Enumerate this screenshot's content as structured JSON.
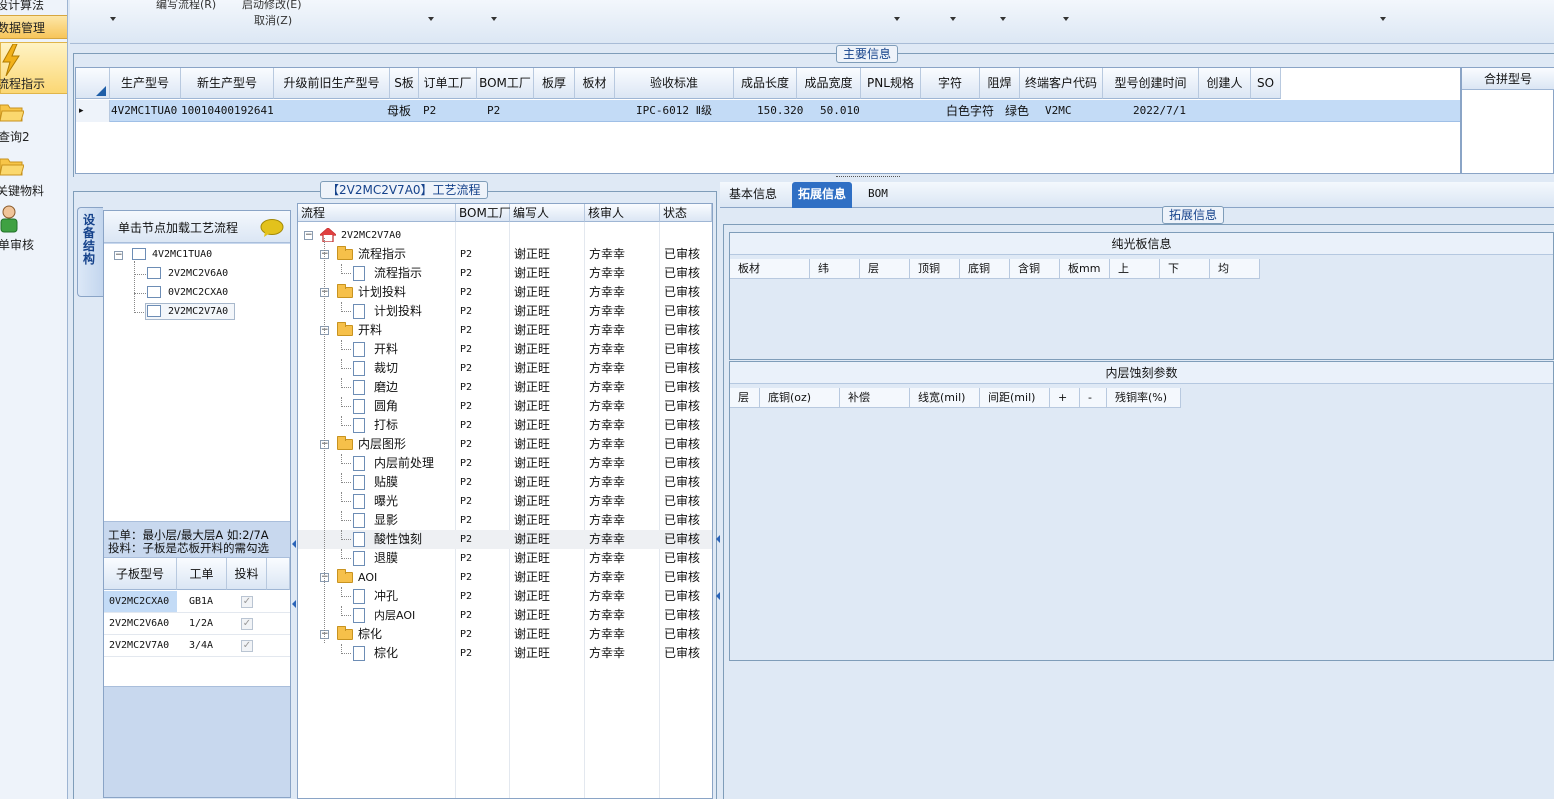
{
  "left_nav": {
    "items": [
      {
        "label": "设计算法"
      },
      {
        "label": "数据管理"
      },
      {
        "label": "流程指示"
      },
      {
        "label": "查询2"
      },
      {
        "label": "关键物料"
      },
      {
        "label": "单审核"
      }
    ]
  },
  "toolbar": {
    "edit_flow": "编写流程(R)",
    "start_modify": "启动修改(E)",
    "cancel": "取消(Z)"
  },
  "main_info": {
    "title": "主要信息",
    "columns": [
      "生产型号",
      "新生产型号",
      "升级前旧生产型号",
      "S板",
      "订单工厂",
      "BOM工厂",
      "板厚",
      "板材",
      "验收标准",
      "成品长度",
      "成品宽度",
      "PNL规格",
      "字符",
      "阻焊",
      "终端客户代码",
      "型号创建时间",
      "创建人",
      "SO"
    ],
    "row": {
      "marker": "▸",
      "生产型号": "4V2MC1TUA0",
      "新生产型号": "10010400192641",
      "升级前旧生产型号": "",
      "S板": "母板",
      "订单工厂": "P2",
      "BOM工厂": "P2",
      "板厚": "",
      "板材": "",
      "验收标准": "IPC-6012 Ⅱ级",
      "成品长度": "150.320",
      "成品宽度": "50.010",
      "PNL规格": "",
      "字符": "白色字符",
      "阻焊": "绿色",
      "终端客户代码": "V2MC",
      "型号创建时间": "2022/7/1",
      "创建人": "",
      "SO": ""
    },
    "merge_header": "合拼型号"
  },
  "device_panel": {
    "vertical_tab": "设备结构",
    "hint": "单击节点加载工艺流程",
    "tree_root": "4V2MC1TUA0",
    "tree_children": [
      "2V2MC2V6A0",
      "0V2MC2CXA0",
      "2V2MC2V7A0"
    ],
    "note_line1": "工单：最小层/最大层A 如:2/7A",
    "note_line2": "投料：子板是芯板开料的需勾选",
    "sub_columns": [
      "子板型号",
      "工单",
      "投料"
    ],
    "sub_rows": [
      {
        "model": "0V2MC2CXA0",
        "order": "GB1A"
      },
      {
        "model": "2V2MC2V6A0",
        "order": "1/2A"
      },
      {
        "model": "2V2MC2V7A0",
        "order": "3/4A"
      }
    ]
  },
  "flow_panel": {
    "title": "【2V2MC2V7A0】工艺流程",
    "columns": [
      "流程",
      "BOM工厂",
      "编写人",
      "核审人",
      "状态"
    ],
    "root": "2V2MC2V7A0",
    "rows": [
      {
        "level": 1,
        "type": "folder",
        "name": "流程指示",
        "bom": "P2",
        "writer": "谢正旺",
        "reviewer": "方幸幸",
        "status": "已审核"
      },
      {
        "level": 2,
        "type": "doc",
        "name": "流程指示",
        "bom": "P2",
        "writer": "谢正旺",
        "reviewer": "方幸幸",
        "status": "已审核"
      },
      {
        "level": 1,
        "type": "folder",
        "name": "计划投料",
        "bom": "P2",
        "writer": "谢正旺",
        "reviewer": "方幸幸",
        "status": "已审核"
      },
      {
        "level": 2,
        "type": "doc",
        "name": "计划投料",
        "bom": "P2",
        "writer": "谢正旺",
        "reviewer": "方幸幸",
        "status": "已审核"
      },
      {
        "level": 1,
        "type": "folder",
        "name": "开料",
        "bom": "P2",
        "writer": "谢正旺",
        "reviewer": "方幸幸",
        "status": "已审核"
      },
      {
        "level": 2,
        "type": "doc",
        "name": "开料",
        "bom": "P2",
        "writer": "谢正旺",
        "reviewer": "方幸幸",
        "status": "已审核"
      },
      {
        "level": 2,
        "type": "doc",
        "name": "裁切",
        "bom": "P2",
        "writer": "谢正旺",
        "reviewer": "方幸幸",
        "status": "已审核"
      },
      {
        "level": 2,
        "type": "doc",
        "name": "磨边",
        "bom": "P2",
        "writer": "谢正旺",
        "reviewer": "方幸幸",
        "status": "已审核"
      },
      {
        "level": 2,
        "type": "doc",
        "name": "圆角",
        "bom": "P2",
        "writer": "谢正旺",
        "reviewer": "方幸幸",
        "status": "已审核"
      },
      {
        "level": 2,
        "type": "doc",
        "name": "打标",
        "bom": "P2",
        "writer": "谢正旺",
        "reviewer": "方幸幸",
        "status": "已审核"
      },
      {
        "level": 1,
        "type": "folder",
        "name": "内层图形",
        "bom": "P2",
        "writer": "谢正旺",
        "reviewer": "方幸幸",
        "status": "已审核"
      },
      {
        "level": 2,
        "type": "doc",
        "name": "内层前处理",
        "bom": "P2",
        "writer": "谢正旺",
        "reviewer": "方幸幸",
        "status": "已审核"
      },
      {
        "level": 2,
        "type": "doc",
        "name": "贴膜",
        "bom": "P2",
        "writer": "谢正旺",
        "reviewer": "方幸幸",
        "status": "已审核"
      },
      {
        "level": 2,
        "type": "doc",
        "name": "曝光",
        "bom": "P2",
        "writer": "谢正旺",
        "reviewer": "方幸幸",
        "status": "已审核"
      },
      {
        "level": 2,
        "type": "doc",
        "name": "显影",
        "bom": "P2",
        "writer": "谢正旺",
        "reviewer": "方幸幸",
        "status": "已审核"
      },
      {
        "level": 2,
        "type": "doc",
        "name": "酸性蚀刻",
        "bom": "P2",
        "writer": "谢正旺",
        "reviewer": "方幸幸",
        "status": "已审核",
        "selected": true
      },
      {
        "level": 2,
        "type": "doc",
        "name": "退膜",
        "bom": "P2",
        "writer": "谢正旺",
        "reviewer": "方幸幸",
        "status": "已审核"
      },
      {
        "level": 1,
        "type": "folder",
        "name": "AOI",
        "bom": "P2",
        "writer": "谢正旺",
        "reviewer": "方幸幸",
        "status": "已审核"
      },
      {
        "level": 2,
        "type": "doc",
        "name": "冲孔",
        "bom": "P2",
        "writer": "谢正旺",
        "reviewer": "方幸幸",
        "status": "已审核"
      },
      {
        "level": 2,
        "type": "doc",
        "name": "内层AOI",
        "bom": "P2",
        "writer": "谢正旺",
        "reviewer": "方幸幸",
        "status": "已审核"
      },
      {
        "level": 1,
        "type": "folder",
        "name": "棕化",
        "bom": "P2",
        "writer": "谢正旺",
        "reviewer": "方幸幸",
        "status": "已审核"
      },
      {
        "level": 2,
        "type": "doc",
        "name": "棕化",
        "bom": "P2",
        "writer": "谢正旺",
        "reviewer": "方幸幸",
        "status": "已审核"
      }
    ]
  },
  "right_panel": {
    "tabs": [
      "基本信息",
      "拓展信息",
      "BOM"
    ],
    "active_tab": "拓展信息",
    "group_title": "拓展信息",
    "plain_board": {
      "title": "纯光板信息",
      "columns": [
        "板材",
        "纬",
        "层",
        "顶铜",
        "底铜",
        "含铜",
        "板mm",
        "上",
        "下",
        "均"
      ]
    },
    "inner_etch": {
      "title": "内层蚀刻参数",
      "columns": [
        "层",
        "底铜(oz)",
        "补偿",
        "线宽(mil)",
        "间距(mil)",
        "+",
        "-",
        "残铜率(%)"
      ]
    }
  },
  "colors": {
    "selected_row": "#c3dbf6",
    "active_tab": "#2f6fc4",
    "panel_bg": "#dfe9f5"
  }
}
